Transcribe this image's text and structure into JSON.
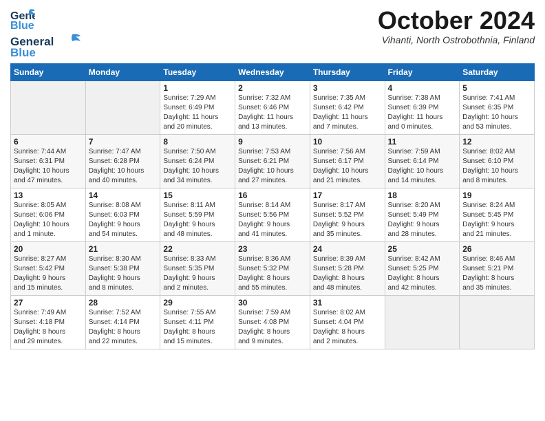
{
  "logo": {
    "line1": "General",
    "line2": "Blue"
  },
  "header": {
    "month": "October 2024",
    "location": "Vihanti, North Ostrobothnia, Finland"
  },
  "weekdays": [
    "Sunday",
    "Monday",
    "Tuesday",
    "Wednesday",
    "Thursday",
    "Friday",
    "Saturday"
  ],
  "weeks": [
    [
      {
        "day": "",
        "info": ""
      },
      {
        "day": "",
        "info": ""
      },
      {
        "day": "1",
        "info": "Sunrise: 7:29 AM\nSunset: 6:49 PM\nDaylight: 11 hours\nand 20 minutes."
      },
      {
        "day": "2",
        "info": "Sunrise: 7:32 AM\nSunset: 6:46 PM\nDaylight: 11 hours\nand 13 minutes."
      },
      {
        "day": "3",
        "info": "Sunrise: 7:35 AM\nSunset: 6:42 PM\nDaylight: 11 hours\nand 7 minutes."
      },
      {
        "day": "4",
        "info": "Sunrise: 7:38 AM\nSunset: 6:39 PM\nDaylight: 11 hours\nand 0 minutes."
      },
      {
        "day": "5",
        "info": "Sunrise: 7:41 AM\nSunset: 6:35 PM\nDaylight: 10 hours\nand 53 minutes."
      }
    ],
    [
      {
        "day": "6",
        "info": "Sunrise: 7:44 AM\nSunset: 6:31 PM\nDaylight: 10 hours\nand 47 minutes."
      },
      {
        "day": "7",
        "info": "Sunrise: 7:47 AM\nSunset: 6:28 PM\nDaylight: 10 hours\nand 40 minutes."
      },
      {
        "day": "8",
        "info": "Sunrise: 7:50 AM\nSunset: 6:24 PM\nDaylight: 10 hours\nand 34 minutes."
      },
      {
        "day": "9",
        "info": "Sunrise: 7:53 AM\nSunset: 6:21 PM\nDaylight: 10 hours\nand 27 minutes."
      },
      {
        "day": "10",
        "info": "Sunrise: 7:56 AM\nSunset: 6:17 PM\nDaylight: 10 hours\nand 21 minutes."
      },
      {
        "day": "11",
        "info": "Sunrise: 7:59 AM\nSunset: 6:14 PM\nDaylight: 10 hours\nand 14 minutes."
      },
      {
        "day": "12",
        "info": "Sunrise: 8:02 AM\nSunset: 6:10 PM\nDaylight: 10 hours\nand 8 minutes."
      }
    ],
    [
      {
        "day": "13",
        "info": "Sunrise: 8:05 AM\nSunset: 6:06 PM\nDaylight: 10 hours\nand 1 minute."
      },
      {
        "day": "14",
        "info": "Sunrise: 8:08 AM\nSunset: 6:03 PM\nDaylight: 9 hours\nand 54 minutes."
      },
      {
        "day": "15",
        "info": "Sunrise: 8:11 AM\nSunset: 5:59 PM\nDaylight: 9 hours\nand 48 minutes."
      },
      {
        "day": "16",
        "info": "Sunrise: 8:14 AM\nSunset: 5:56 PM\nDaylight: 9 hours\nand 41 minutes."
      },
      {
        "day": "17",
        "info": "Sunrise: 8:17 AM\nSunset: 5:52 PM\nDaylight: 9 hours\nand 35 minutes."
      },
      {
        "day": "18",
        "info": "Sunrise: 8:20 AM\nSunset: 5:49 PM\nDaylight: 9 hours\nand 28 minutes."
      },
      {
        "day": "19",
        "info": "Sunrise: 8:24 AM\nSunset: 5:45 PM\nDaylight: 9 hours\nand 21 minutes."
      }
    ],
    [
      {
        "day": "20",
        "info": "Sunrise: 8:27 AM\nSunset: 5:42 PM\nDaylight: 9 hours\nand 15 minutes."
      },
      {
        "day": "21",
        "info": "Sunrise: 8:30 AM\nSunset: 5:38 PM\nDaylight: 9 hours\nand 8 minutes."
      },
      {
        "day": "22",
        "info": "Sunrise: 8:33 AM\nSunset: 5:35 PM\nDaylight: 9 hours\nand 2 minutes."
      },
      {
        "day": "23",
        "info": "Sunrise: 8:36 AM\nSunset: 5:32 PM\nDaylight: 8 hours\nand 55 minutes."
      },
      {
        "day": "24",
        "info": "Sunrise: 8:39 AM\nSunset: 5:28 PM\nDaylight: 8 hours\nand 48 minutes."
      },
      {
        "day": "25",
        "info": "Sunrise: 8:42 AM\nSunset: 5:25 PM\nDaylight: 8 hours\nand 42 minutes."
      },
      {
        "day": "26",
        "info": "Sunrise: 8:46 AM\nSunset: 5:21 PM\nDaylight: 8 hours\nand 35 minutes."
      }
    ],
    [
      {
        "day": "27",
        "info": "Sunrise: 7:49 AM\nSunset: 4:18 PM\nDaylight: 8 hours\nand 29 minutes."
      },
      {
        "day": "28",
        "info": "Sunrise: 7:52 AM\nSunset: 4:14 PM\nDaylight: 8 hours\nand 22 minutes."
      },
      {
        "day": "29",
        "info": "Sunrise: 7:55 AM\nSunset: 4:11 PM\nDaylight: 8 hours\nand 15 minutes."
      },
      {
        "day": "30",
        "info": "Sunrise: 7:59 AM\nSunset: 4:08 PM\nDaylight: 8 hours\nand 9 minutes."
      },
      {
        "day": "31",
        "info": "Sunrise: 8:02 AM\nSunset: 4:04 PM\nDaylight: 8 hours\nand 2 minutes."
      },
      {
        "day": "",
        "info": ""
      },
      {
        "day": "",
        "info": ""
      }
    ]
  ]
}
